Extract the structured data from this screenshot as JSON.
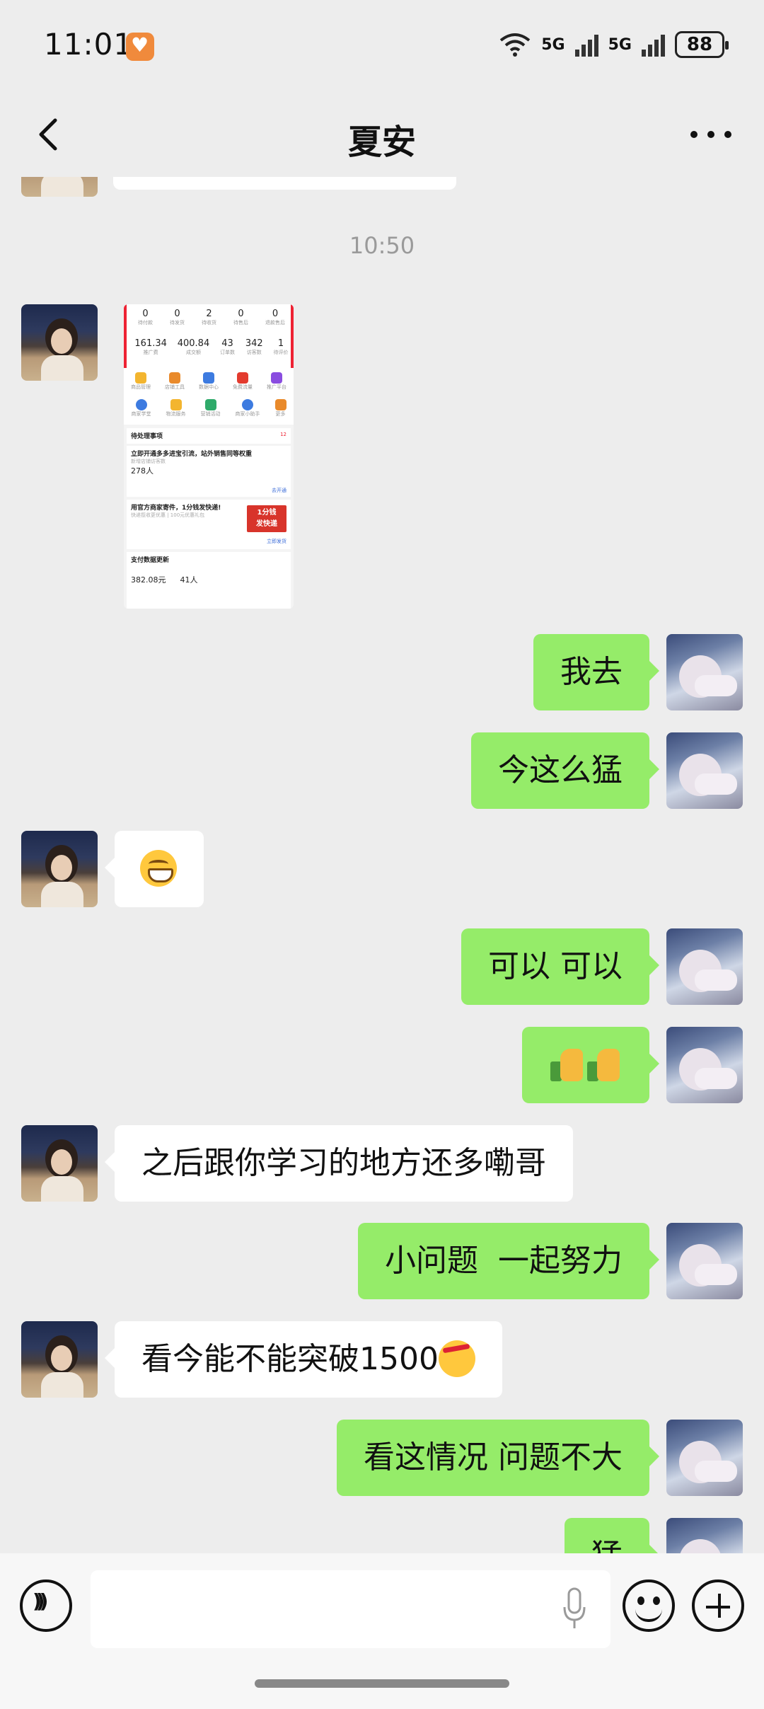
{
  "status_bar": {
    "time": "11:01",
    "network_1": "5G",
    "network_2": "5G",
    "battery": "88"
  },
  "header": {
    "title": "夏安",
    "back_icon": "chevron-left-icon",
    "more_icon": "more-horizontal-icon"
  },
  "timestamp": "10:50",
  "screenshot_card": {
    "stats_top": [
      {
        "value": "0",
        "label": "待付款"
      },
      {
        "value": "0",
        "label": "待发货"
      },
      {
        "value": "2",
        "label": "待收货"
      },
      {
        "value": "0",
        "label": "待售后"
      },
      {
        "value": "0",
        "label": "退款售后"
      }
    ],
    "stats_bottom": [
      {
        "value": "161.34",
        "label": "推广费"
      },
      {
        "value": "400.84",
        "label": "成交额"
      },
      {
        "value": "43",
        "label": "订单数"
      },
      {
        "value": "342",
        "label": "访客数"
      },
      {
        "value": "1",
        "label": "待评价"
      }
    ],
    "icons_row1": [
      "商品管理",
      "店铺工具",
      "数据中心",
      "免费流量",
      "推广平台"
    ],
    "icons_row2": [
      "商家学堂",
      "物流服务",
      "营销活动",
      "商家小助手",
      "更多"
    ],
    "todo_header": "待处理事项",
    "todo_count": "12",
    "card1_title": "立即开通多多进宝引流，站外销售同等权重",
    "card1_sub": "新增店铺访客数",
    "card1_value": "278人",
    "card1_link": "去开通",
    "card2_title": "用官方商家寄件，1分钱发快递!",
    "card2_sub": "快递揽收更优惠 | 100元优惠礼包",
    "card2_link": "立即发货",
    "card2_badge_1": "1分钱",
    "card2_badge_2": "发快递",
    "card3_title": "支付数据更新",
    "card3_value_1": "382.08元",
    "card3_value_2": "41人"
  },
  "messages": [
    {
      "side": "out",
      "text": "我去"
    },
    {
      "side": "out",
      "text": "今这么猛"
    },
    {
      "side": "in",
      "text": "",
      "emoji": "grinning-face"
    },
    {
      "side": "out",
      "text": "可以 可以"
    },
    {
      "side": "out",
      "text": "",
      "emoji": "thumbs-up x2"
    },
    {
      "side": "in",
      "text": "之后跟你学习的地方还多嘞哥"
    },
    {
      "side": "out",
      "text": "小问题  一起努力"
    },
    {
      "side": "in",
      "text": "看今能不能突破1500",
      "emoji": "thinking-face"
    },
    {
      "side": "out",
      "text": "看这情况 问题不大"
    },
    {
      "side": "out",
      "text": "猛"
    }
  ],
  "input_bar": {
    "voice_icon": "voice-icon",
    "mic_icon": "microphone-icon",
    "emoji_icon": "emoji-icon",
    "plus_icon": "plus-icon"
  },
  "colors": {
    "outgoing_bubble": "#95ec69",
    "incoming_bubble": "#ffffff",
    "background": "#ededed"
  }
}
